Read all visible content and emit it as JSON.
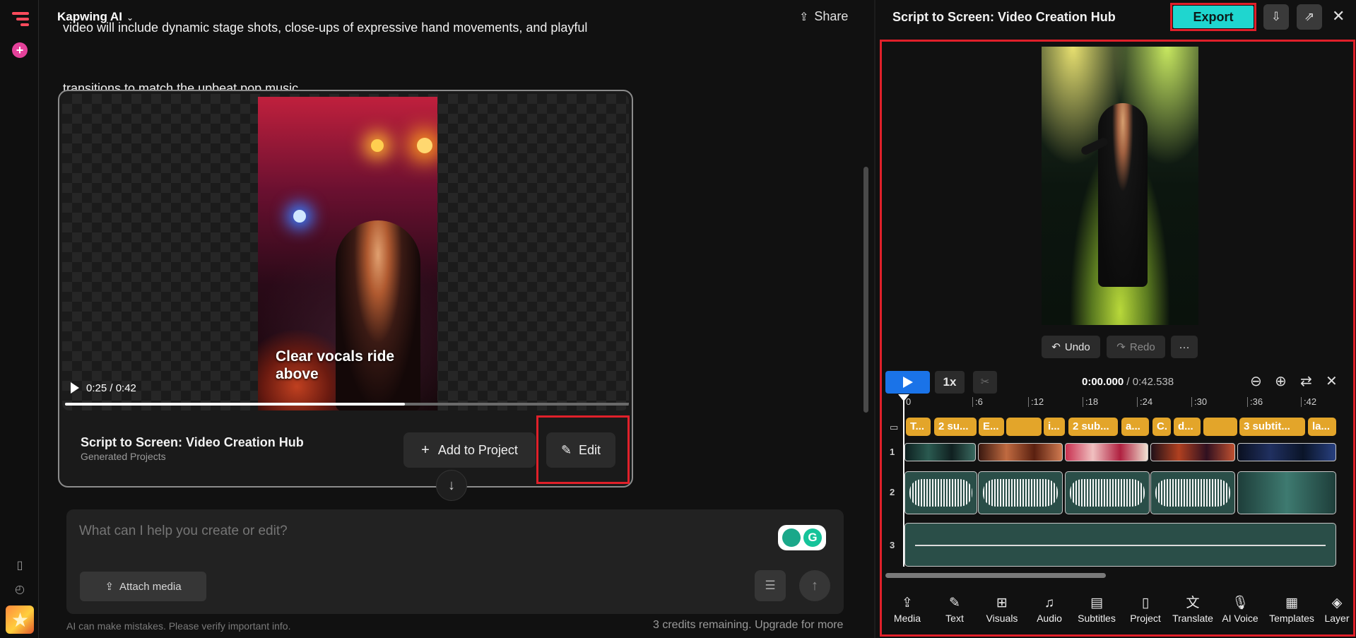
{
  "topbar": {
    "brand": "Kapwing AI",
    "share_label": "Share"
  },
  "conversation": {
    "prompt_line1": "video will include dynamic stage shots, close-ups of expressive hand movements, and playful",
    "prompt_line2": "transitions to match the upbeat pop music."
  },
  "video_card": {
    "caption": "Clear vocals ride above",
    "time": "0:25 / 0:42",
    "progress": 0.6,
    "title": "Script to Screen: Video Creation Hub",
    "subtitle": "Generated Projects",
    "add_label": "Add to Project",
    "edit_label": "Edit"
  },
  "chat": {
    "placeholder": "What can I help you create or edit?",
    "attach_label": "Attach media",
    "disclaimer": "AI can make mistakes. Please verify important info.",
    "credits": "3 credits remaining. Upgrade for more"
  },
  "editor": {
    "title": "Script to Screen: Video Creation Hub",
    "export_label": "Export",
    "undo_label": "Undo",
    "redo_label": "Redo",
    "more_label": "···",
    "speed": "1x",
    "time_current": "0:00.000",
    "time_total": "/ 0:42.538",
    "ruler_ticks": [
      "0",
      ":6",
      ":12",
      ":18",
      ":24",
      ":30",
      ":36",
      ":42"
    ],
    "track_labels": [
      "1",
      "2",
      "3"
    ],
    "subtitle_chips": [
      "T...",
      "2 su...",
      "E...",
      "",
      "i...",
      "2 sub...",
      "a...",
      "C.",
      "d...",
      "",
      "3 subtit...",
      "la..."
    ],
    "tools": [
      "Media",
      "Text",
      "Visuals",
      "Audio",
      "Subtitles",
      "Project",
      "Translate",
      "AI Voice",
      "Templates",
      "Layer"
    ]
  },
  "colors": {
    "accent": "#1fd6cf",
    "play": "#1a73e8",
    "subtitle": "#e3a52a",
    "highlight": "#e0202a",
    "brand": "#ff4b5c"
  }
}
